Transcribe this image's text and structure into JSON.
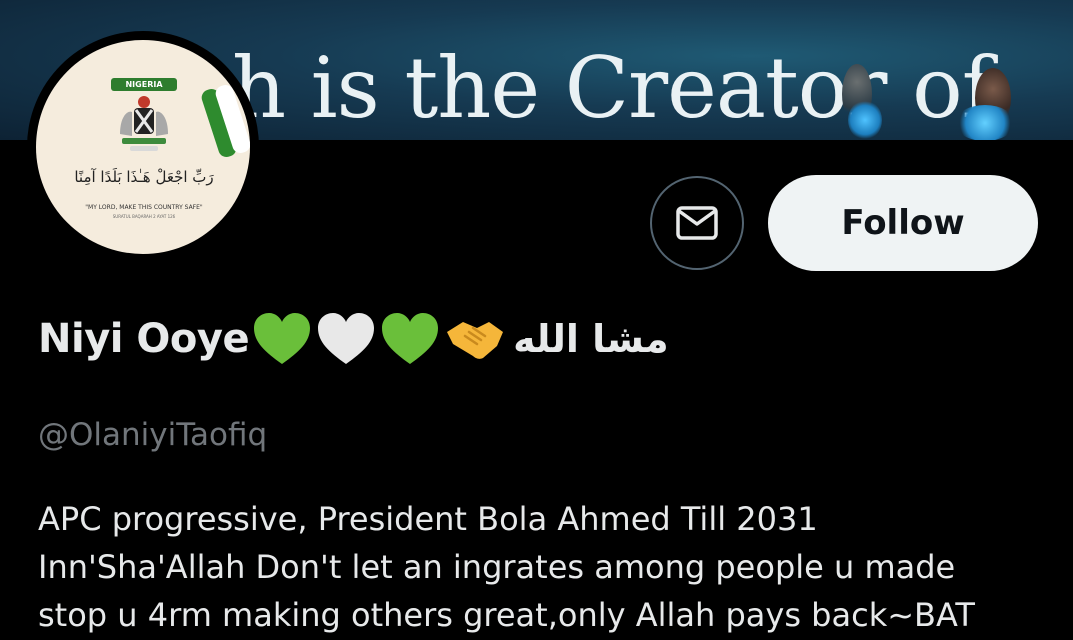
{
  "banner": {
    "text": "h is the Creator of"
  },
  "avatar": {
    "badge": "NIGERIA",
    "arabic": "رَبِّ اجْعَلْ هَـٰذَا بَلَدًا آمِنًا",
    "caption": "\"MY LORD, MAKE THIS COUNTRY SAFE\"",
    "subcaption": "SURATUL BAQARAH 2 AYAT 126"
  },
  "actions": {
    "message_icon": "envelope-icon",
    "follow_label": "Follow"
  },
  "profile": {
    "name": "Niyi Ooye",
    "name_arabic": "مشا الله",
    "emoji_icons": [
      "green-heart-icon",
      "white-heart-icon",
      "green-heart-icon",
      "handshake-icon"
    ],
    "handle": "@OlaniyiTaofiq",
    "bio_lines": [
      "APC progressive, President Bola Ahmed Till 2031",
      "Inn'Sha'Allah Don't let an ingrates among people u made",
      "stop u 4rm making others great,only Allah pays back~BAT"
    ]
  },
  "colors": {
    "background": "#000000",
    "primary_text": "#e7e9ea",
    "secondary_text": "#71767b",
    "follow_bg": "#eff3f4",
    "green_heart": "#6abf3a",
    "white_heart": "#e8e8e8",
    "handshake": "#f5b63a"
  }
}
